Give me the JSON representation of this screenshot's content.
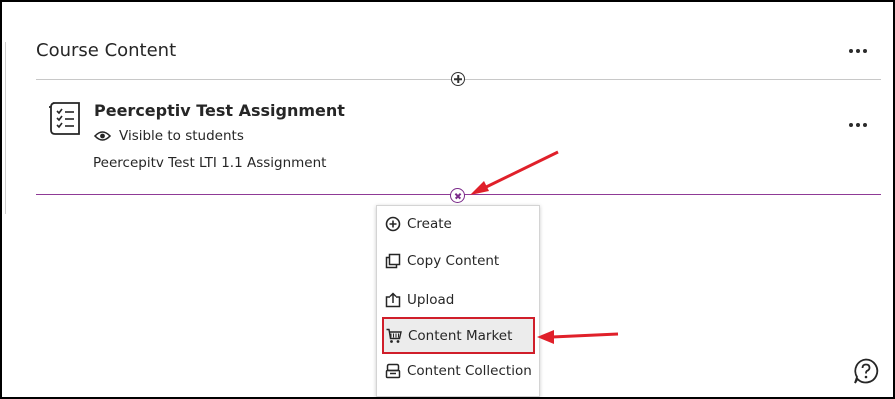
{
  "section": {
    "title": "Course Content"
  },
  "assignment": {
    "title": "Peerceptiv Test Assignment",
    "visibility": "Visible to students",
    "description": "Peercepitv Test LTI 1.1 Assignment"
  },
  "menu": {
    "items": [
      {
        "label": "Create",
        "icon": "plus-circle-icon"
      },
      {
        "label": "Copy Content",
        "icon": "copy-icon"
      },
      {
        "label": "Upload",
        "icon": "upload-icon"
      },
      {
        "label": "Content Market",
        "icon": "cart-icon"
      },
      {
        "label": "Content Collection",
        "icon": "database-icon"
      }
    ]
  },
  "colors": {
    "accent_line": "#8f3a96",
    "highlight_border": "#d01e2a",
    "arrow": "#e0202a"
  }
}
